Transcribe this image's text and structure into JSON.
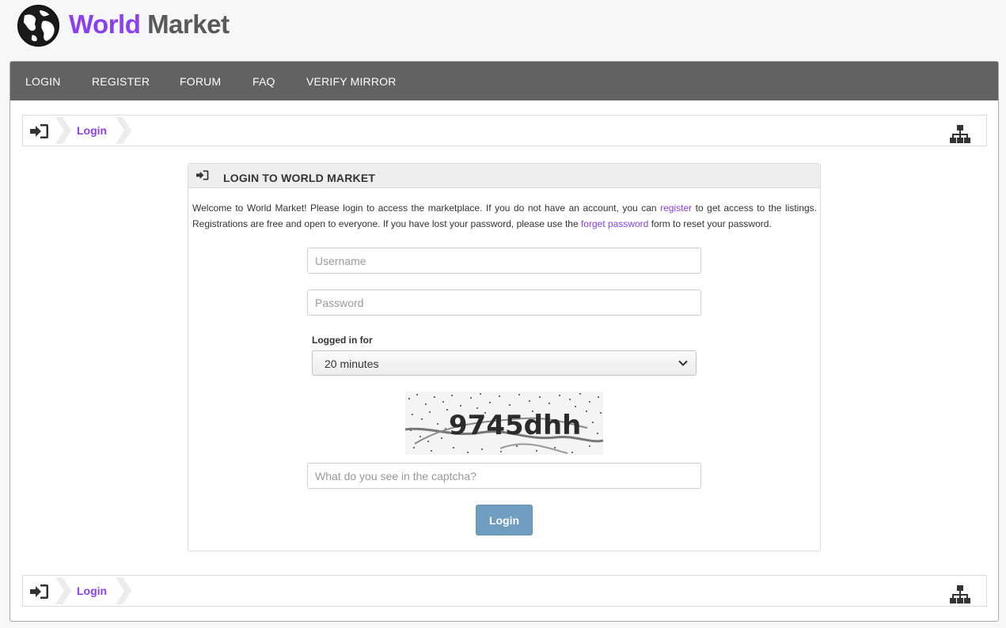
{
  "brand": {
    "word1": "World",
    "word2": "Market",
    "accent": "#8a3ff2",
    "dark": "#58595b"
  },
  "nav": {
    "items": [
      {
        "label": "LOGIN"
      },
      {
        "label": "REGISTER"
      },
      {
        "label": "FORUM"
      },
      {
        "label": "FAQ"
      },
      {
        "label": "VERIFY MIRROR"
      }
    ]
  },
  "breadcrumb": {
    "icon": "sign-in-icon",
    "label": "Login",
    "right_icon": "sitemap-icon"
  },
  "panel": {
    "icon": "sign-in-icon",
    "title": "LOGIN TO WORLD MARKET",
    "intro_1": "Welcome to World Market! Please login to access the marketplace. If you do not have an account, you can ",
    "register_link": "register",
    "intro_2": " to get access to the listings. Registrations are free and open to everyone. If you have lost your password, please use the ",
    "forget_link": "forget password",
    "intro_3": " form to reset your password."
  },
  "form": {
    "username_placeholder": "Username",
    "password_placeholder": "Password",
    "session_label": "Logged in for",
    "session_value": "20 minutes",
    "captcha_text": "9745dhh",
    "captcha_placeholder": "What do you see in the captcha?",
    "submit_label": "Login",
    "button_color": "#6f9ec0"
  }
}
